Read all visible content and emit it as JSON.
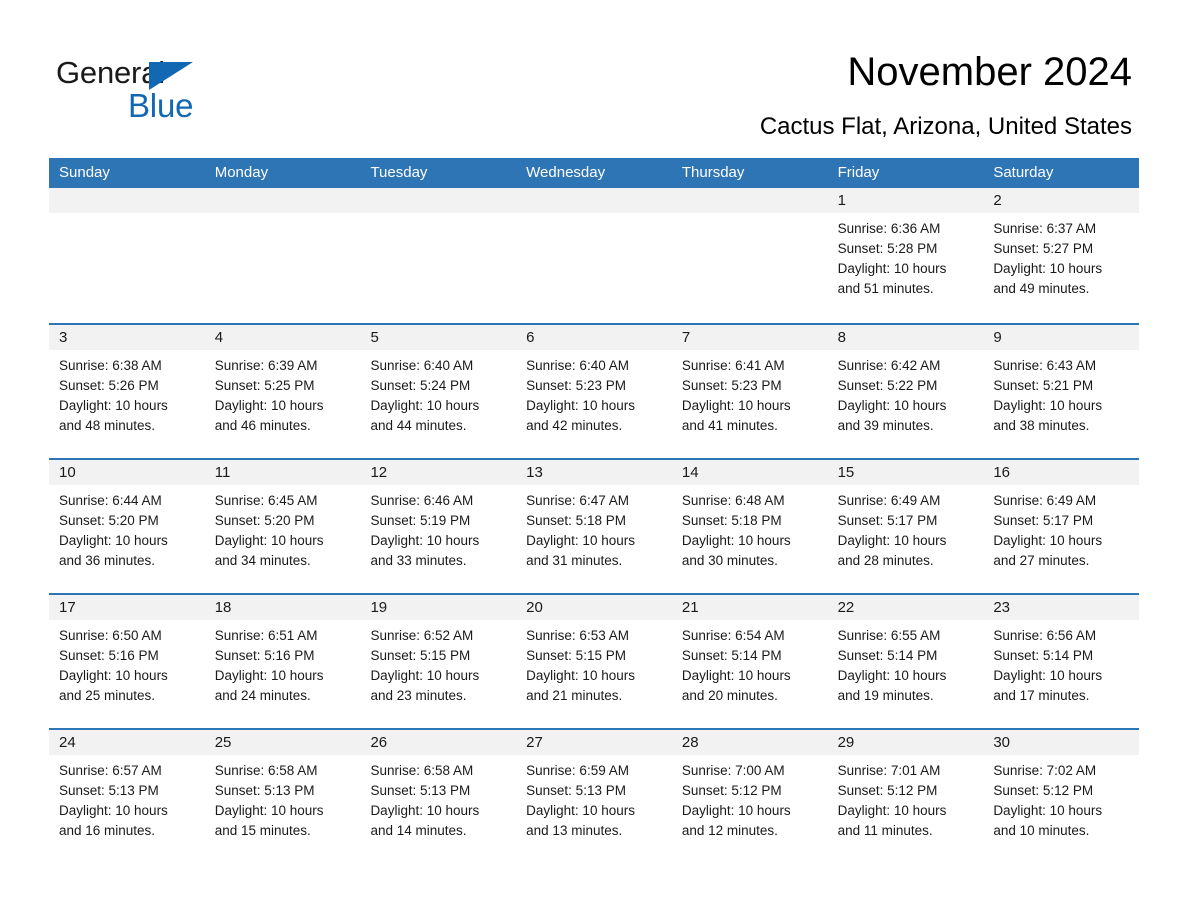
{
  "brand": {
    "name_part1": "General",
    "name_part2": "Blue",
    "accent_color": "#1268b3",
    "logo_icon": "triangle-flag-icon"
  },
  "header": {
    "title": "November 2024",
    "subtitle": "Cactus Flat, Arizona, United States"
  },
  "calendar": {
    "header_bg": "#2e75b6",
    "day_band_bg": "#f2f2f2",
    "weekdays": [
      "Sunday",
      "Monday",
      "Tuesday",
      "Wednesday",
      "Thursday",
      "Friday",
      "Saturday"
    ],
    "weeks": [
      [
        {
          "day": "",
          "lines": []
        },
        {
          "day": "",
          "lines": []
        },
        {
          "day": "",
          "lines": []
        },
        {
          "day": "",
          "lines": []
        },
        {
          "day": "",
          "lines": []
        },
        {
          "day": "1",
          "lines": [
            "Sunrise: 6:36 AM",
            "Sunset: 5:28 PM",
            "Daylight: 10 hours",
            "and 51 minutes."
          ]
        },
        {
          "day": "2",
          "lines": [
            "Sunrise: 6:37 AM",
            "Sunset: 5:27 PM",
            "Daylight: 10 hours",
            "and 49 minutes."
          ]
        }
      ],
      [
        {
          "day": "3",
          "lines": [
            "Sunrise: 6:38 AM",
            "Sunset: 5:26 PM",
            "Daylight: 10 hours",
            "and 48 minutes."
          ]
        },
        {
          "day": "4",
          "lines": [
            "Sunrise: 6:39 AM",
            "Sunset: 5:25 PM",
            "Daylight: 10 hours",
            "and 46 minutes."
          ]
        },
        {
          "day": "5",
          "lines": [
            "Sunrise: 6:40 AM",
            "Sunset: 5:24 PM",
            "Daylight: 10 hours",
            "and 44 minutes."
          ]
        },
        {
          "day": "6",
          "lines": [
            "Sunrise: 6:40 AM",
            "Sunset: 5:23 PM",
            "Daylight: 10 hours",
            "and 42 minutes."
          ]
        },
        {
          "day": "7",
          "lines": [
            "Sunrise: 6:41 AM",
            "Sunset: 5:23 PM",
            "Daylight: 10 hours",
            "and 41 minutes."
          ]
        },
        {
          "day": "8",
          "lines": [
            "Sunrise: 6:42 AM",
            "Sunset: 5:22 PM",
            "Daylight: 10 hours",
            "and 39 minutes."
          ]
        },
        {
          "day": "9",
          "lines": [
            "Sunrise: 6:43 AM",
            "Sunset: 5:21 PM",
            "Daylight: 10 hours",
            "and 38 minutes."
          ]
        }
      ],
      [
        {
          "day": "10",
          "lines": [
            "Sunrise: 6:44 AM",
            "Sunset: 5:20 PM",
            "Daylight: 10 hours",
            "and 36 minutes."
          ]
        },
        {
          "day": "11",
          "lines": [
            "Sunrise: 6:45 AM",
            "Sunset: 5:20 PM",
            "Daylight: 10 hours",
            "and 34 minutes."
          ]
        },
        {
          "day": "12",
          "lines": [
            "Sunrise: 6:46 AM",
            "Sunset: 5:19 PM",
            "Daylight: 10 hours",
            "and 33 minutes."
          ]
        },
        {
          "day": "13",
          "lines": [
            "Sunrise: 6:47 AM",
            "Sunset: 5:18 PM",
            "Daylight: 10 hours",
            "and 31 minutes."
          ]
        },
        {
          "day": "14",
          "lines": [
            "Sunrise: 6:48 AM",
            "Sunset: 5:18 PM",
            "Daylight: 10 hours",
            "and 30 minutes."
          ]
        },
        {
          "day": "15",
          "lines": [
            "Sunrise: 6:49 AM",
            "Sunset: 5:17 PM",
            "Daylight: 10 hours",
            "and 28 minutes."
          ]
        },
        {
          "day": "16",
          "lines": [
            "Sunrise: 6:49 AM",
            "Sunset: 5:17 PM",
            "Daylight: 10 hours",
            "and 27 minutes."
          ]
        }
      ],
      [
        {
          "day": "17",
          "lines": [
            "Sunrise: 6:50 AM",
            "Sunset: 5:16 PM",
            "Daylight: 10 hours",
            "and 25 minutes."
          ]
        },
        {
          "day": "18",
          "lines": [
            "Sunrise: 6:51 AM",
            "Sunset: 5:16 PM",
            "Daylight: 10 hours",
            "and 24 minutes."
          ]
        },
        {
          "day": "19",
          "lines": [
            "Sunrise: 6:52 AM",
            "Sunset: 5:15 PM",
            "Daylight: 10 hours",
            "and 23 minutes."
          ]
        },
        {
          "day": "20",
          "lines": [
            "Sunrise: 6:53 AM",
            "Sunset: 5:15 PM",
            "Daylight: 10 hours",
            "and 21 minutes."
          ]
        },
        {
          "day": "21",
          "lines": [
            "Sunrise: 6:54 AM",
            "Sunset: 5:14 PM",
            "Daylight: 10 hours",
            "and 20 minutes."
          ]
        },
        {
          "day": "22",
          "lines": [
            "Sunrise: 6:55 AM",
            "Sunset: 5:14 PM",
            "Daylight: 10 hours",
            "and 19 minutes."
          ]
        },
        {
          "day": "23",
          "lines": [
            "Sunrise: 6:56 AM",
            "Sunset: 5:14 PM",
            "Daylight: 10 hours",
            "and 17 minutes."
          ]
        }
      ],
      [
        {
          "day": "24",
          "lines": [
            "Sunrise: 6:57 AM",
            "Sunset: 5:13 PM",
            "Daylight: 10 hours",
            "and 16 minutes."
          ]
        },
        {
          "day": "25",
          "lines": [
            "Sunrise: 6:58 AM",
            "Sunset: 5:13 PM",
            "Daylight: 10 hours",
            "and 15 minutes."
          ]
        },
        {
          "day": "26",
          "lines": [
            "Sunrise: 6:58 AM",
            "Sunset: 5:13 PM",
            "Daylight: 10 hours",
            "and 14 minutes."
          ]
        },
        {
          "day": "27",
          "lines": [
            "Sunrise: 6:59 AM",
            "Sunset: 5:13 PM",
            "Daylight: 10 hours",
            "and 13 minutes."
          ]
        },
        {
          "day": "28",
          "lines": [
            "Sunrise: 7:00 AM",
            "Sunset: 5:12 PM",
            "Daylight: 10 hours",
            "and 12 minutes."
          ]
        },
        {
          "day": "29",
          "lines": [
            "Sunrise: 7:01 AM",
            "Sunset: 5:12 PM",
            "Daylight: 10 hours",
            "and 11 minutes."
          ]
        },
        {
          "day": "30",
          "lines": [
            "Sunrise: 7:02 AM",
            "Sunset: 5:12 PM",
            "Daylight: 10 hours",
            "and 10 minutes."
          ]
        }
      ]
    ]
  }
}
